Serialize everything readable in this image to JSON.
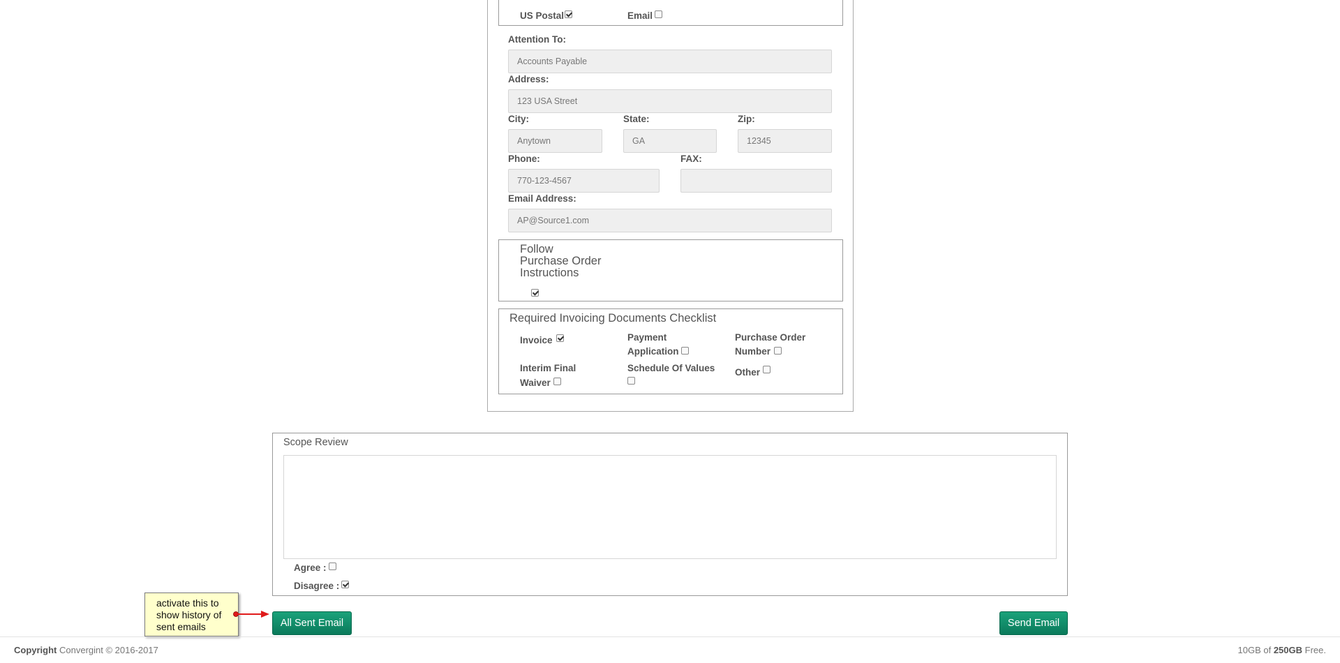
{
  "delivery": {
    "us_postal_label": "US Postal",
    "us_postal_checked": true,
    "email_label": "Email",
    "email_checked": false
  },
  "address_form": {
    "attention_label": "Attention To:",
    "attention_value": "Accounts Payable",
    "address_label": "Address:",
    "address_value": "123 USA Street",
    "city_label": "City:",
    "city_value": "Anytown",
    "state_label": "State:",
    "state_value": "GA",
    "zip_label": "Zip:",
    "zip_value": "12345",
    "phone_label": "Phone:",
    "phone_value": "770-123-4567",
    "fax_label": "FAX:",
    "fax_value": "",
    "email_label": "Email Address:",
    "email_value": "AP@Source1.com"
  },
  "po_instructions": {
    "line1": "Follow",
    "line2": "Purchase Order",
    "line3": "Instructions",
    "checked": true
  },
  "checklist": {
    "title": "Required Invoicing Documents Checklist",
    "invoice": "Invoice",
    "payment_line1": "Payment",
    "payment_line2": "Application",
    "po_number_line1": "Purchase Order",
    "po_number_line2": "Number",
    "interim_line1": "Interim Final",
    "interim_line2": "Waiver",
    "schedule": "Schedule Of Values",
    "other": "Other"
  },
  "scope_review": {
    "title": "Scope Review",
    "text": "",
    "agree_label": "Agree :",
    "disagree_label": "Disagree :"
  },
  "callout": {
    "text_line1": "activate this to",
    "text_line2": "show history of",
    "text_line3": "sent emails"
  },
  "buttons": {
    "all_sent_email": "All Sent Email",
    "send_email": "Send Email"
  },
  "footer": {
    "copyright_bold": "Copyright",
    "copyright_rest": "Convergint © 2016-2017",
    "storage_used": "10GB of",
    "storage_total": "250GB",
    "storage_suffix": "Free."
  },
  "colors": {
    "button_green": "#0b7a5b",
    "callout_bg": "#ffffcc",
    "arrow_red": "#e01b1b"
  }
}
